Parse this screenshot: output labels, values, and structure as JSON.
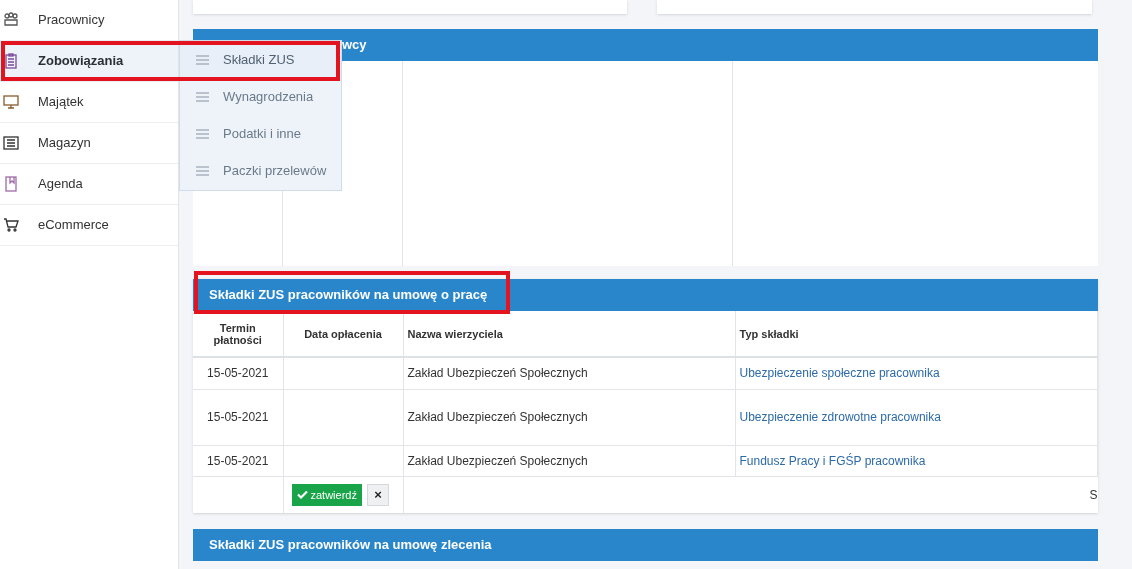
{
  "sidebar": {
    "items": [
      {
        "label": "Pracownicy",
        "selected": false
      },
      {
        "label": "Zobowiązania",
        "selected": true
      },
      {
        "label": "Majątek",
        "selected": false
      },
      {
        "label": "Magazyn",
        "selected": false
      },
      {
        "label": "Agenda",
        "selected": false
      },
      {
        "label": "eCommerce",
        "selected": false
      }
    ]
  },
  "submenu": {
    "items": [
      {
        "label": "Składki ZUS",
        "selected": true
      },
      {
        "label": "Wynagrodzenia",
        "selected": false
      },
      {
        "label": "Podatki i inne",
        "selected": false
      },
      {
        "label": "Paczki przelewów",
        "selected": false
      }
    ]
  },
  "panel_1": {
    "title": "wcy"
  },
  "panel_2": {
    "title": "Składki ZUS pracowników na umowę o pracę",
    "columns": [
      "Termin płatności",
      "Data opłacenia",
      "Nazwa wierzyciela",
      "Typ składki"
    ],
    "rows": [
      [
        "15-05-2021",
        "",
        "Zakład Ubezpieczeń Społecznych",
        "Ubezpieczenie społeczne pracownika"
      ],
      [
        "15-05-2021",
        "",
        "Zakład Ubezpieczeń Społecznych",
        "Ubezpieczenie zdrowotne pracownika"
      ],
      [
        "15-05-2021",
        "",
        "Zakład Ubezpieczeń Społecznych",
        "Fundusz Pracy i FGŚP pracownika"
      ]
    ],
    "confirm_button": "zatwierdź",
    "cancel_button": "×",
    "footer_text": "S"
  },
  "panel_3": {
    "title": "Składki ZUS pracowników na umowę zlecenia"
  }
}
